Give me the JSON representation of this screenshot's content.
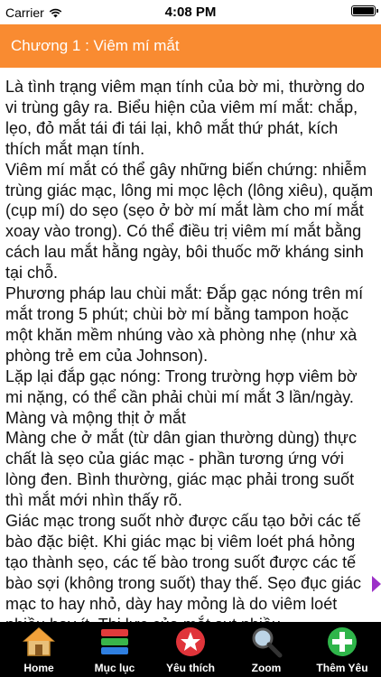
{
  "status_bar": {
    "carrier": "Carrier",
    "time": "4:08 PM"
  },
  "header": {
    "title": "Chương 1 : Viêm mí mắt"
  },
  "content": {
    "paragraphs": [
      "Là tình trạng viêm mạn tính của bờ mi, thường do vi trùng gây ra. Biểu hiện của viêm mí mắt: chắp, lẹo, đỏ mắt tái đi tái lại, khô mắt thứ phát, kích thích mắt mạn tính.",
      "Viêm mí mắt có thể gây những biến chứng: nhiễm trùng giác mạc, lông mi mọc lệch (lông xiêu), quặm (cụp mí) do sẹo (sẹo ở bờ mí mắt làm cho mí mắt xoay vào trong). Có thể điều trị viêm mí mắt bằng cách lau mắt hằng ngày, bôi thuốc mỡ kháng sinh tại chỗ.",
      "Phương pháp lau chùi mắt: Đắp gạc nóng trên mí mắt trong 5 phút; chùi bờ mí bằng tampon hoặc một khăn mềm nhúng vào xà phòng nhẹ (như xà phòng trẻ em của Johnson).",
      "Lặp lại đắp gạc nóng: Trong trường hợp viêm bờ mi nặng, có thể cần phải chùi mí mắt 3 lần/ngày.",
      "Màng và mộng thịt ở mắt",
      "Màng che ở mắt (từ dân gian thường dùng) thực chất là sẹo của giác mạc - phần tương ứng với lòng đen. Bình thường, giác mạc phải trong suốt thì mắt mới nhìn thấy rõ.",
      "Giác mạc trong suốt nhờ được cấu tạo bởi các tế bào đặc biệt. Khi giác mạc bị viêm loét phá hỏng tạo thành sẹo, các tế bào trong suốt được các tế bào sợi (không trong suốt) thay thế. Sẹo đục giác mạc to hay nhỏ, dày hay mỏng là do viêm loét nhiều hay ít. Thị lực của mắt sụt nhiều"
    ]
  },
  "tabbar": {
    "items": [
      {
        "label": "Home",
        "icon": "house-icon"
      },
      {
        "label": "Mục lục",
        "icon": "list-icon"
      },
      {
        "label": "Yêu thích",
        "icon": "star-icon"
      },
      {
        "label": "Zoom",
        "icon": "magnifier-icon"
      },
      {
        "label": "Thêm Yêu",
        "icon": "plus-icon"
      }
    ]
  },
  "colors": {
    "header_bg": "#f98b31",
    "tabbar_bg": "#000000",
    "scroll_arrow": "#9b30c8"
  }
}
